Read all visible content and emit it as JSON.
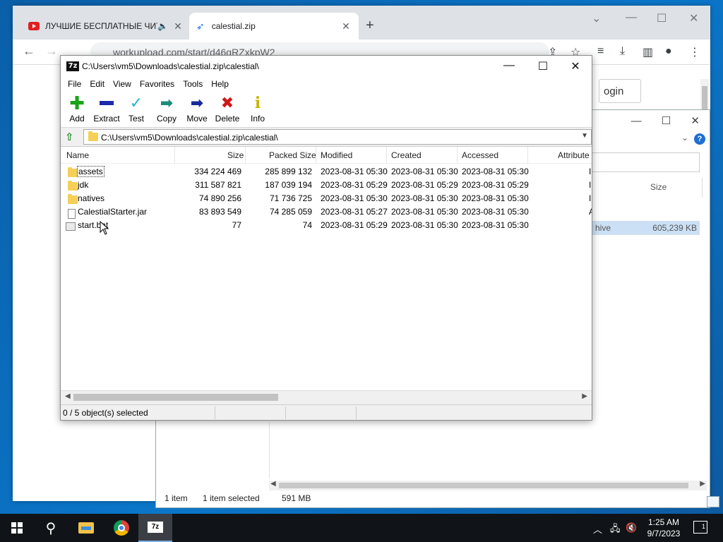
{
  "chrome": {
    "tabs": [
      {
        "title": "ЛУЧШИЕ БЕСПЛАТНЫЕ ЧИТ",
        "icon": "youtube-icon",
        "active": false
      },
      {
        "title": "calestial.zip",
        "icon": "rocket-icon",
        "active": true
      }
    ],
    "new_tab": "+",
    "url": "workupload.com/start/d46gRZxkpW2",
    "login_label": "ogin"
  },
  "explorer": {
    "size_header": "Size",
    "row_type": "hive",
    "row_size": "605,239 KB",
    "status": {
      "count": "1 item",
      "selected": "1 item selected",
      "size": "591 MB"
    }
  },
  "sevenzip": {
    "title": "C:\\Users\\vm5\\Downloads\\calestial.zip\\calestial\\",
    "menu": [
      "File",
      "Edit",
      "View",
      "Favorites",
      "Tools",
      "Help"
    ],
    "toolbar": [
      {
        "label": "Add",
        "icon": "add-icon",
        "color": "#1aa31a"
      },
      {
        "label": "Extract",
        "icon": "extract-icon",
        "color": "#1a2aa8"
      },
      {
        "label": "Test",
        "icon": "test-icon",
        "color": "#22b6c8"
      },
      {
        "label": "Copy",
        "icon": "copy-icon",
        "color": "#1d8c7a"
      },
      {
        "label": "Move",
        "icon": "move-icon",
        "color": "#1a2a9a"
      },
      {
        "label": "Delete",
        "icon": "delete-icon",
        "color": "#d01818"
      },
      {
        "label": "Info",
        "icon": "info-icon",
        "color": "#c8b400"
      }
    ],
    "address": "C:\\Users\\vm5\\Downloads\\calestial.zip\\calestial\\",
    "columns": [
      "Name",
      "Size",
      "Packed Size",
      "Modified",
      "Created",
      "Accessed",
      "Attribute"
    ],
    "rows": [
      {
        "name": "assets",
        "type": "folder",
        "size": "334 224 469",
        "packed": "285 899 132",
        "modified": "2023-08-31 05:30",
        "created": "2023-08-31 05:30",
        "accessed": "2023-08-31 05:30",
        "attr": "I"
      },
      {
        "name": "jdk",
        "type": "folder",
        "size": "311 587 821",
        "packed": "187 039 194",
        "modified": "2023-08-31 05:29",
        "created": "2023-08-31 05:29",
        "accessed": "2023-08-31 05:29",
        "attr": "I"
      },
      {
        "name": "natives",
        "type": "folder",
        "size": "74 890 256",
        "packed": "71 736 725",
        "modified": "2023-08-31 05:30",
        "created": "2023-08-31 05:30",
        "accessed": "2023-08-31 05:30",
        "attr": "I"
      },
      {
        "name": "CalestialStarter.jar",
        "type": "file",
        "size": "83 893 549",
        "packed": "74 285 059",
        "modified": "2023-08-31 05:27",
        "created": "2023-08-31 05:30",
        "accessed": "2023-08-31 05:30",
        "attr": "A"
      },
      {
        "name": "start.bat",
        "type": "bat",
        "size": "77",
        "packed": "74",
        "modified": "2023-08-31 05:29",
        "created": "2023-08-31 05:30",
        "accessed": "2023-08-31 05:30",
        "attr": ""
      }
    ],
    "status": "0 / 5 object(s) selected"
  },
  "taskbar": {
    "time": "1:25 AM",
    "date": "9/7/2023",
    "notifications": "1"
  }
}
